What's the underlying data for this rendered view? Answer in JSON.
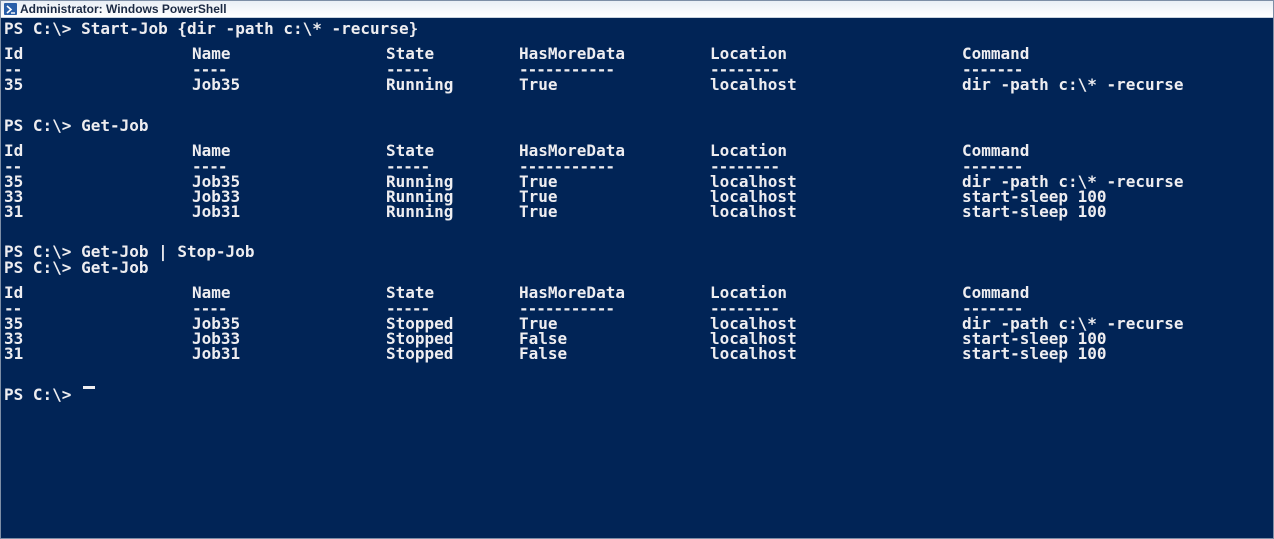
{
  "window": {
    "title": "Administrator: Windows PowerShell",
    "background": "#012456",
    "foreground": "#EEEDF0"
  },
  "columns": {
    "headers": [
      "Id",
      "Name",
      "State",
      "HasMoreData",
      "Location",
      "Command"
    ],
    "underlines": [
      "--",
      "----",
      "-----",
      "-----------",
      "--------",
      "-------"
    ]
  },
  "blocks": [
    {
      "commands": [
        "PS C:\\> Start-Job {dir -path c:\\* -recurse}"
      ],
      "rows": [
        [
          "35",
          "Job35",
          "Running",
          "True",
          "localhost",
          "dir -path c:\\* -recurse"
        ]
      ]
    },
    {
      "commands": [
        "PS C:\\> Get-Job"
      ],
      "rows": [
        [
          "35",
          "Job35",
          "Running",
          "True",
          "localhost",
          "dir -path c:\\* -recurse"
        ],
        [
          "33",
          "Job33",
          "Running",
          "True",
          "localhost",
          "start-sleep 100"
        ],
        [
          "31",
          "Job31",
          "Running",
          "True",
          "localhost",
          "start-sleep 100"
        ]
      ]
    },
    {
      "commands": [
        "PS C:\\> Get-Job | Stop-Job",
        "PS C:\\> Get-Job"
      ],
      "rows": [
        [
          "35",
          "Job35",
          "Stopped",
          "True",
          "localhost",
          "dir -path c:\\* -recurse"
        ],
        [
          "33",
          "Job33",
          "Stopped",
          "False",
          "localhost",
          "start-sleep 100"
        ],
        [
          "31",
          "Job31",
          "Stopped",
          "False",
          "localhost",
          "start-sleep 100"
        ]
      ]
    }
  ],
  "prompt": "PS C:\\>"
}
